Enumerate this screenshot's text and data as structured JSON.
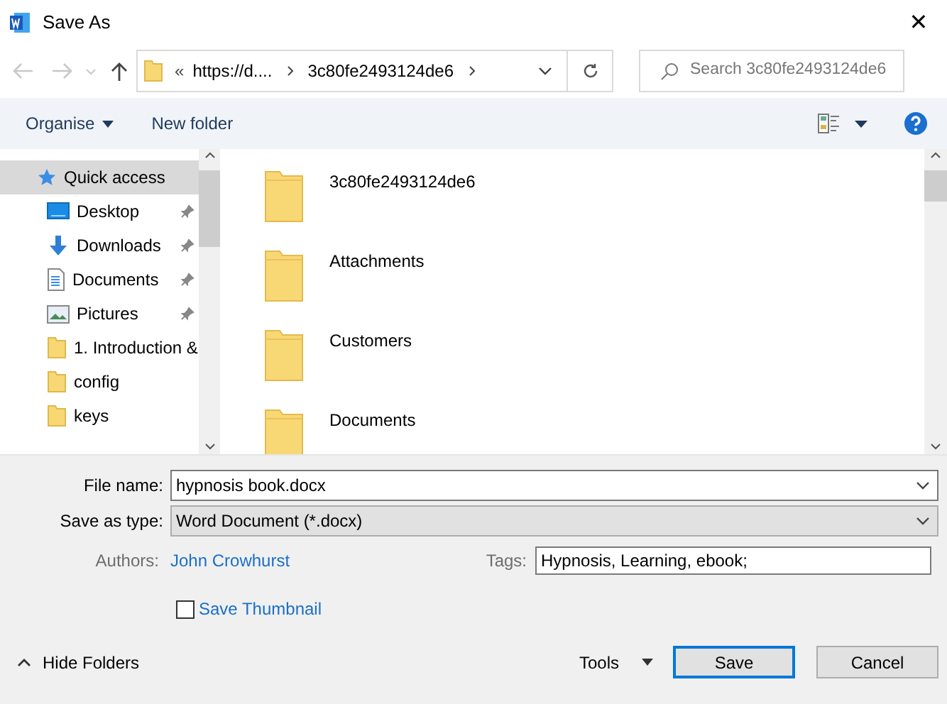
{
  "window": {
    "title": "Save As",
    "close": "✕"
  },
  "address": {
    "overflow": "«",
    "segments": [
      "https://d....",
      "3c80fe2493124de6"
    ]
  },
  "search": {
    "placeholder": "Search 3c80fe2493124de6"
  },
  "toolbar": {
    "organise": "Organise",
    "new_folder": "New folder"
  },
  "sidebar": {
    "items": [
      {
        "label": "Quick access",
        "kind": "star",
        "pinned": false,
        "selected": true
      },
      {
        "label": "Desktop",
        "kind": "desktop",
        "pinned": true,
        "selected": false
      },
      {
        "label": "Downloads",
        "kind": "download",
        "pinned": true,
        "selected": false
      },
      {
        "label": "Documents",
        "kind": "documents",
        "pinned": true,
        "selected": false
      },
      {
        "label": "Pictures",
        "kind": "pictures",
        "pinned": true,
        "selected": false
      },
      {
        "label": "1. Introduction &",
        "kind": "folder",
        "pinned": false,
        "selected": false
      },
      {
        "label": "config",
        "kind": "folder",
        "pinned": false,
        "selected": false
      },
      {
        "label": "keys",
        "kind": "folder",
        "pinned": false,
        "selected": false
      }
    ]
  },
  "files": [
    {
      "name": "3c80fe2493124de6"
    },
    {
      "name": "Attachments"
    },
    {
      "name": "Customers"
    },
    {
      "name": "Documents"
    }
  ],
  "form": {
    "file_name_label": "File name:",
    "file_name": "hypnosis book.docx",
    "type_label": "Save as type:",
    "type": "Word Document (*.docx)",
    "authors_label": "Authors:",
    "authors": "John Crowhurst",
    "tags_label": "Tags:",
    "tags": "Hypnosis, Learning, ebook;",
    "thumbnail": {
      "label": "Save Thumbnail",
      "checked": false
    }
  },
  "footer": {
    "hide_folders": "Hide Folders",
    "tools": "Tools",
    "save": "Save",
    "cancel": "Cancel"
  }
}
